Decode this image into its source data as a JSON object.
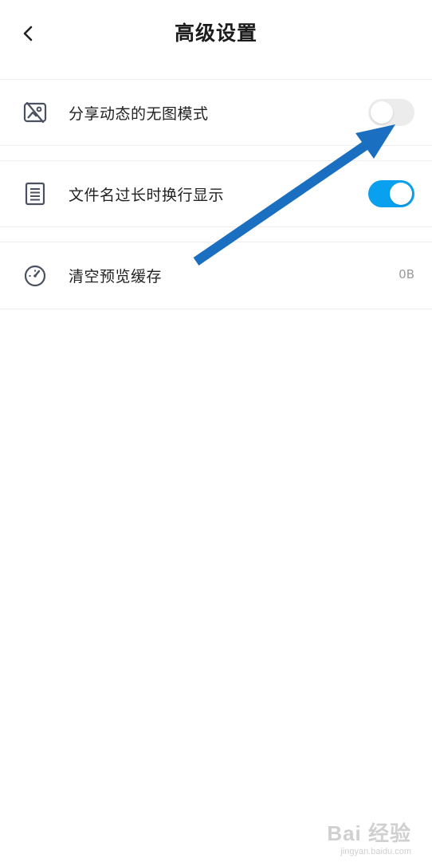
{
  "header": {
    "title": "高级设置",
    "back_icon": "chevron-left-icon"
  },
  "settings": [
    {
      "label": "分享动态的无图模式",
      "icon": "image-off-icon",
      "control": "toggle",
      "enabled": false
    },
    {
      "label": "文件名过长时换行显示",
      "icon": "document-lines-icon",
      "control": "toggle",
      "enabled": true
    },
    {
      "label": "清空预览缓存",
      "icon": "gauge-icon",
      "control": "value",
      "value": "0B"
    }
  ],
  "colors": {
    "accent": "#0aa0f0",
    "toggle_off": "#ececec",
    "annotation_arrow": "#1a6fc1",
    "icon": "#4a5160",
    "divider": "#eeeeee"
  },
  "watermark": {
    "logo": "Bai 经验",
    "sub": "jingyan.baidu.com"
  }
}
